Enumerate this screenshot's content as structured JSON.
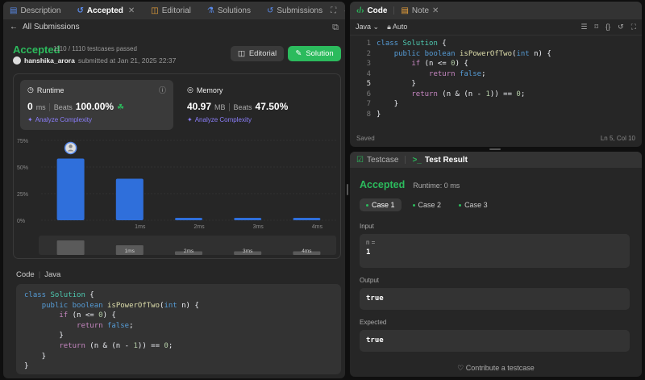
{
  "left_tabs": [
    {
      "label": "Description",
      "icon": "description-icon"
    },
    {
      "label": "Accepted",
      "icon": "history-icon"
    },
    {
      "label": "Editorial",
      "icon": "book-icon"
    },
    {
      "label": "Solutions",
      "icon": "flask-icon"
    },
    {
      "label": "Submissions",
      "icon": "history-icon"
    }
  ],
  "back_label": "All Submissions",
  "submission": {
    "status": "Accepted",
    "testcases": "1110 / 1110 testcases passed",
    "author": "hanshika_arora",
    "submitted": "submitted at Jan 21, 2025 22:37",
    "editorial_btn": "Editorial",
    "solution_btn": "Solution"
  },
  "runtime": {
    "title": "Runtime",
    "value": "0",
    "unit": "ms",
    "beats_label": "Beats",
    "beats": "100.00%",
    "analyze": "Analyze Complexity"
  },
  "memory": {
    "title": "Memory",
    "value": "40.97",
    "unit": "MB",
    "beats_label": "Beats",
    "beats": "47.50%",
    "analyze": "Analyze Complexity"
  },
  "chart_data": {
    "type": "bar",
    "y_ticks": [
      "75%",
      "50%",
      "25%",
      "0%"
    ],
    "ylim": [
      0,
      75
    ],
    "categories": [
      "",
      "1ms",
      "2ms",
      "3ms",
      "4ms"
    ],
    "values": [
      58,
      39,
      2,
      2,
      2
    ],
    "highlighted_index": 0,
    "minimap_labels": [
      "1ms",
      "2ms",
      "3ms",
      "4ms"
    ],
    "colors": {
      "bar": "#2f6fdb",
      "grid": "#3a3a3a"
    }
  },
  "code_section": {
    "label": "Code",
    "lang": "Java"
  },
  "code_lines": [
    "class Solution {",
    "    public boolean isPowerOfTwo(int n) {",
    "        if (n <= 0) {",
    "            return false;",
    "        }",
    "        return (n & (n - 1)) == 0;",
    "    }",
    "}"
  ],
  "editor": {
    "tabs": [
      {
        "label": "Code",
        "icon": "code-icon"
      },
      {
        "label": "Note",
        "icon": "note-icon"
      }
    ],
    "language": "Java",
    "mode": "Auto",
    "line_numbers": [
      "1",
      "2",
      "3",
      "4",
      "5",
      "6",
      "7",
      "8"
    ],
    "saved": "Saved",
    "position": "Ln 5, Col 10"
  },
  "result": {
    "tabs": [
      {
        "label": "Testcase"
      },
      {
        "label": "Test Result"
      }
    ],
    "status": "Accepted",
    "runtime": "Runtime: 0 ms",
    "cases": [
      "Case 1",
      "Case 2",
      "Case 3"
    ],
    "input_label": "Input",
    "var_name": "n =",
    "var_value": "1",
    "output_label": "Output",
    "output_value": "true",
    "expected_label": "Expected",
    "expected_value": "true",
    "contribute": "Contribute a testcase"
  }
}
